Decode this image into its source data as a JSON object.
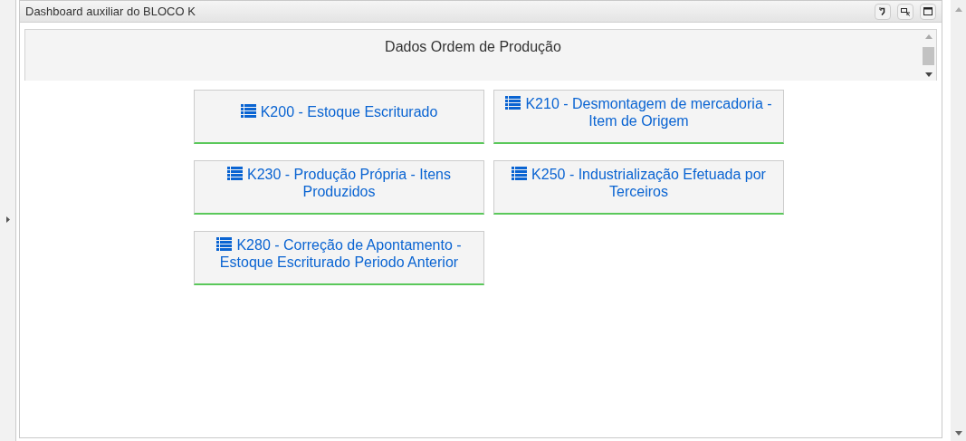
{
  "panel": {
    "title": "Dashboard auxiliar do BLOCO K",
    "tools": [
      {
        "kind": "restore"
      },
      {
        "kind": "popout"
      },
      {
        "kind": "maximize"
      }
    ]
  },
  "section": {
    "title": "Dados Ordem de Produção"
  },
  "buttons": [
    {
      "label": "K200 - Estoque Escriturado"
    },
    {
      "label": "K210 - Desmontagem de mercadoria - Item de Origem"
    },
    {
      "label": "K230 - Produção Própria - Itens Produzidos"
    },
    {
      "label": "K250 - Industrialização Efetuada por Terceiros"
    },
    {
      "label": "K280 - Correção de Apontamento - Estoque Escriturado Periodo Anterior"
    }
  ]
}
